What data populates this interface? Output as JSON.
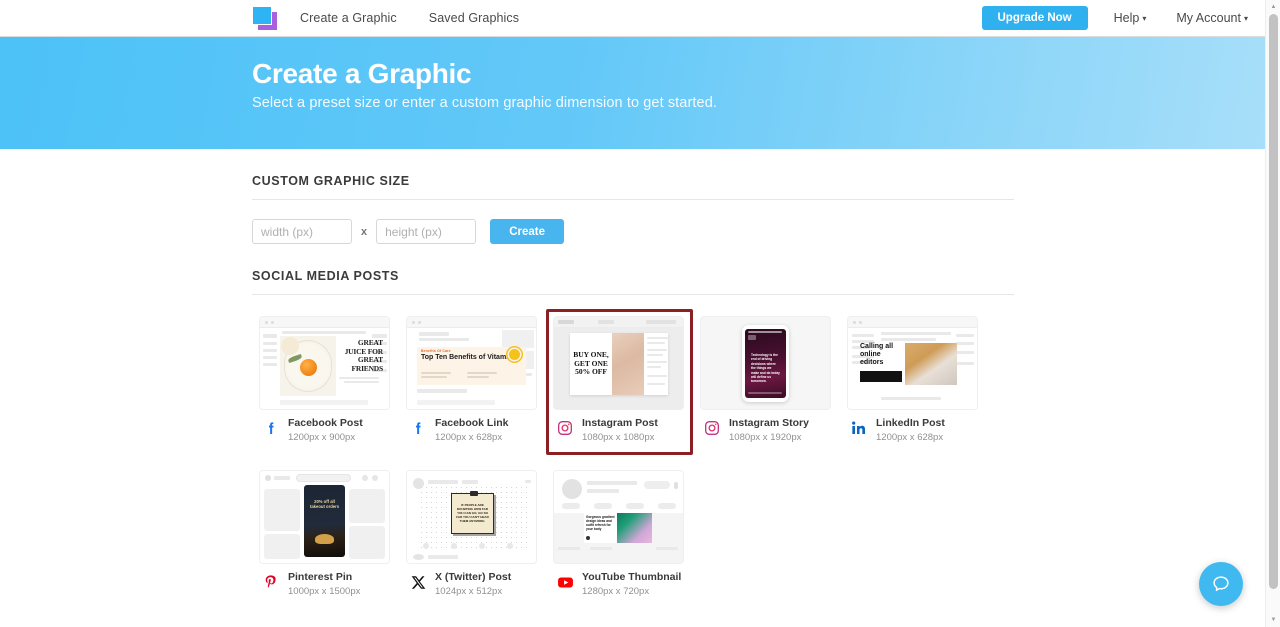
{
  "nav": {
    "logo_name": "app-logo",
    "links": [
      {
        "label": "Create a Graphic"
      },
      {
        "label": "Saved Graphics"
      }
    ],
    "upgrade_label": "Upgrade Now",
    "help_label": "Help",
    "account_label": "My Account",
    "caret": "▾",
    "accent_color": "#2fb0ef"
  },
  "hero": {
    "title": "Create a Graphic",
    "subtitle": "Select a preset size or enter a custom graphic dimension to get started.",
    "gradient_from": "#4cc2f7",
    "gradient_to": "#a9dff9"
  },
  "custom_size": {
    "section_title": "CUSTOM GRAPHIC SIZE",
    "width_value": "",
    "width_placeholder": "width (px)",
    "separator": "x",
    "height_value": "",
    "height_placeholder": "height (px)",
    "create_label": "Create"
  },
  "social": {
    "section_title": "SOCIAL MEDIA POSTS",
    "selected_color": "#8b1f24",
    "cards": [
      {
        "name": "Facebook Post",
        "size": "1200px x 900px",
        "icon": "facebook-icon",
        "selected": false,
        "art": "facebook-post",
        "art_text": "GREAT JUICE FOR GREAT FRIENDS"
      },
      {
        "name": "Facebook Link",
        "size": "1200px x 628px",
        "icon": "facebook-icon",
        "selected": false,
        "art": "facebook-link",
        "art_text": "Top Ten Benefits of Vitamin D",
        "art_kicker": "Benefits Of Care"
      },
      {
        "name": "Instagram Post",
        "size": "1080px x 1080px",
        "icon": "instagram-icon",
        "selected": true,
        "art": "instagram-post",
        "art_text": "BUY ONE, GET ONE 50% OFF"
      },
      {
        "name": "Instagram Story",
        "size": "1080px x 1920px",
        "icon": "instagram-icon",
        "selected": false,
        "art": "instagram-story",
        "art_text": "Technology is the end of driving decisions where the things we make and do today will define us tomorrow."
      },
      {
        "name": "LinkedIn Post",
        "size": "1200px x 628px",
        "icon": "linkedin-icon",
        "selected": false,
        "art": "linkedin-post",
        "art_text": "Calling all online editors"
      },
      {
        "name": "Pinterest Pin",
        "size": "1000px x 1500px",
        "icon": "pinterest-icon",
        "selected": false,
        "art": "pinterest-pin",
        "art_text": "20% off all takeout orders"
      },
      {
        "name": "X (Twitter) Post",
        "size": "1024px x 512px",
        "icon": "x-twitter-icon",
        "selected": false,
        "art": "twitter-post",
        "art_text": "IF PEOPLE ARE DOUBTING HOW FAR YOU CAN GO, GO SO FAR YOU CAN'T HEAR THEM ANYMORE."
      },
      {
        "name": "YouTube Thumbnail",
        "size": "1280px x 720px",
        "icon": "youtube-icon",
        "selected": false,
        "art": "youtube-thumbnail",
        "art_text": "Gorgeous gradient design ideas and outfit refresh for your body"
      }
    ]
  },
  "help_widget": {
    "name": "help-chat-button",
    "color": "#3fb9f0"
  },
  "scrollbar": {
    "up_arrow": "▲",
    "down_arrow": "▼"
  }
}
